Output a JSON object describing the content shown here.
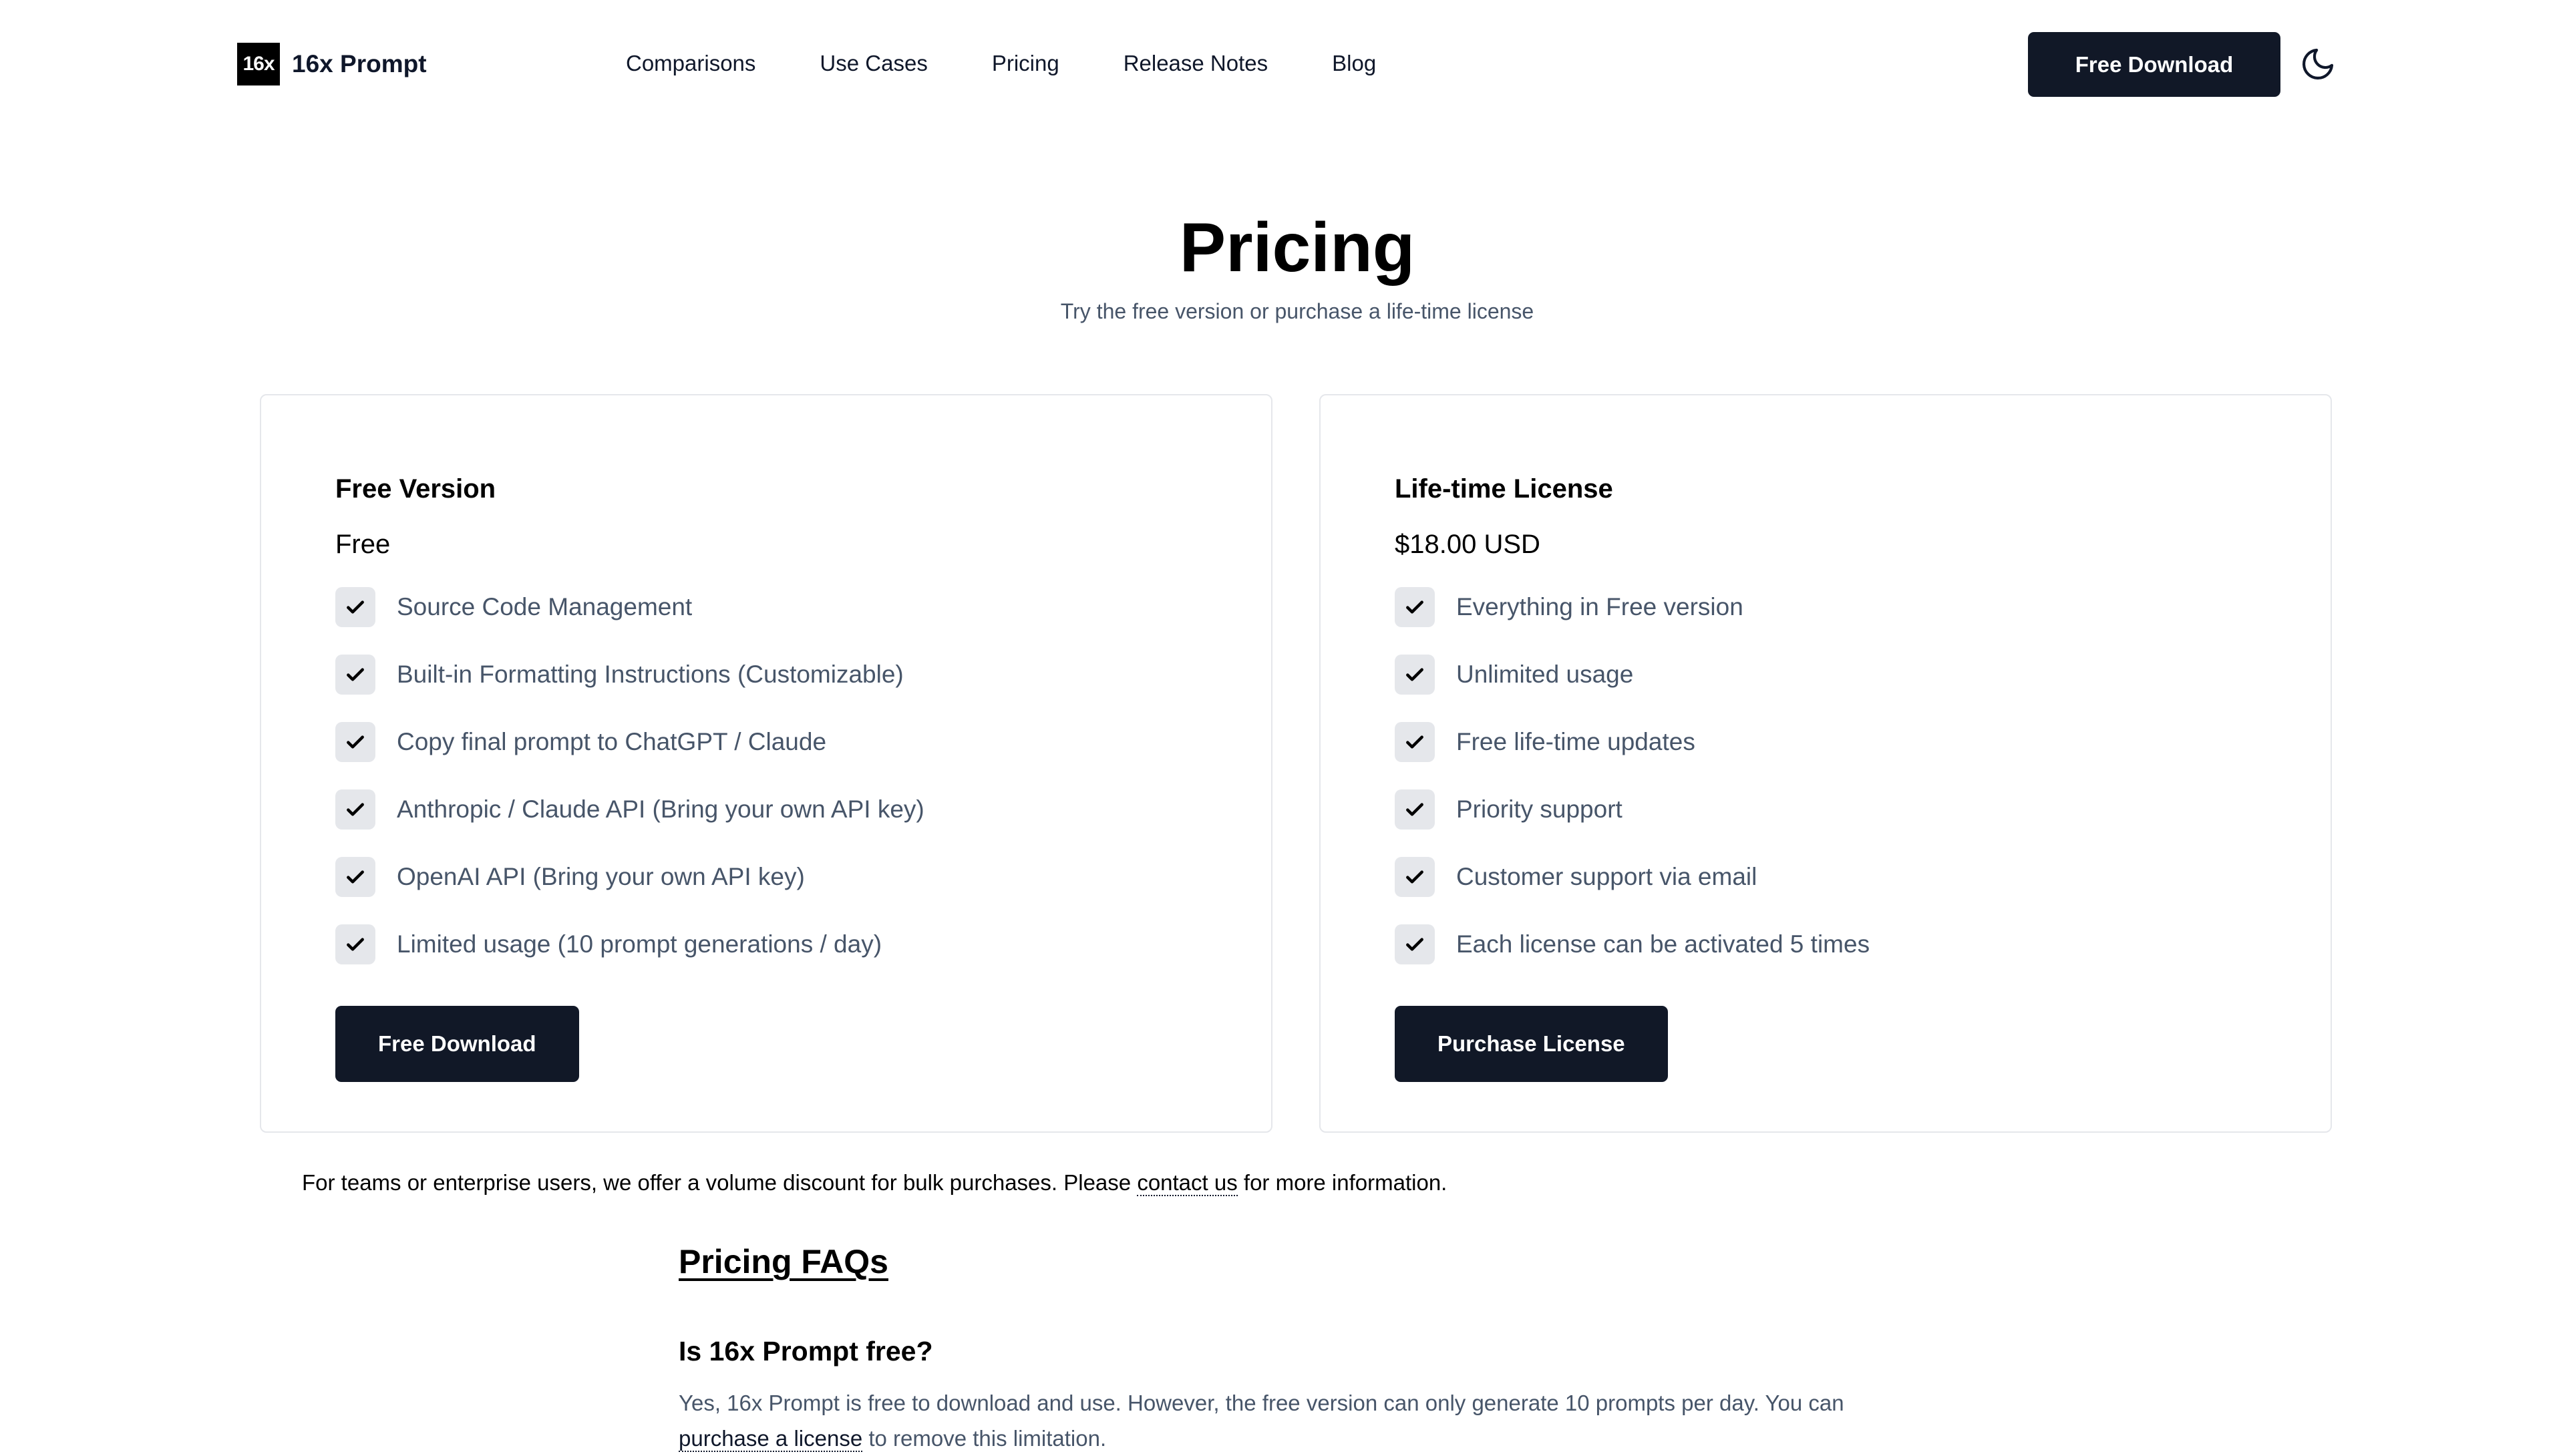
{
  "header": {
    "logo_mark": "16x",
    "logo_text": "16x Prompt",
    "nav": [
      "Comparisons",
      "Use Cases",
      "Pricing",
      "Release Notes",
      "Blog"
    ],
    "download_button": "Free Download",
    "theme_icon": "moon-icon"
  },
  "hero": {
    "title": "Pricing",
    "subtitle": "Try the free version or purchase a life-time license"
  },
  "plans": [
    {
      "title": "Free Version",
      "price": "Free",
      "features": [
        "Source Code Management",
        "Built-in Formatting Instructions (Customizable)",
        "Copy final prompt to ChatGPT / Claude",
        "Anthropic / Claude API (Bring your own API key)",
        "OpenAI API (Bring your own API key)",
        "Limited usage (10 prompt generations / day)"
      ],
      "button": "Free Download"
    },
    {
      "title": "Life-time License",
      "price": "$18.00 USD",
      "features": [
        "Everything in Free version",
        "Unlimited usage",
        "Free life-time updates",
        "Priority support",
        "Customer support via email",
        "Each license can be activated 5 times"
      ],
      "button": "Purchase License"
    }
  ],
  "note": {
    "before": "For teams or enterprise users, we offer a volume discount for bulk purchases. Please ",
    "link": "contact us",
    "after": " for more information."
  },
  "faq": {
    "heading": "Pricing FAQs",
    "question": "Is 16x Prompt free?",
    "answer_before": "Yes, 16x Prompt is free to download and use. However, the free version can only generate 10 prompts per day. You can ",
    "answer_link": "purchase a license",
    "answer_after": " to remove this limitation."
  },
  "colors": {
    "primary_button": "#111827",
    "muted_text": "#475569",
    "card_border": "#e5e7eb"
  }
}
